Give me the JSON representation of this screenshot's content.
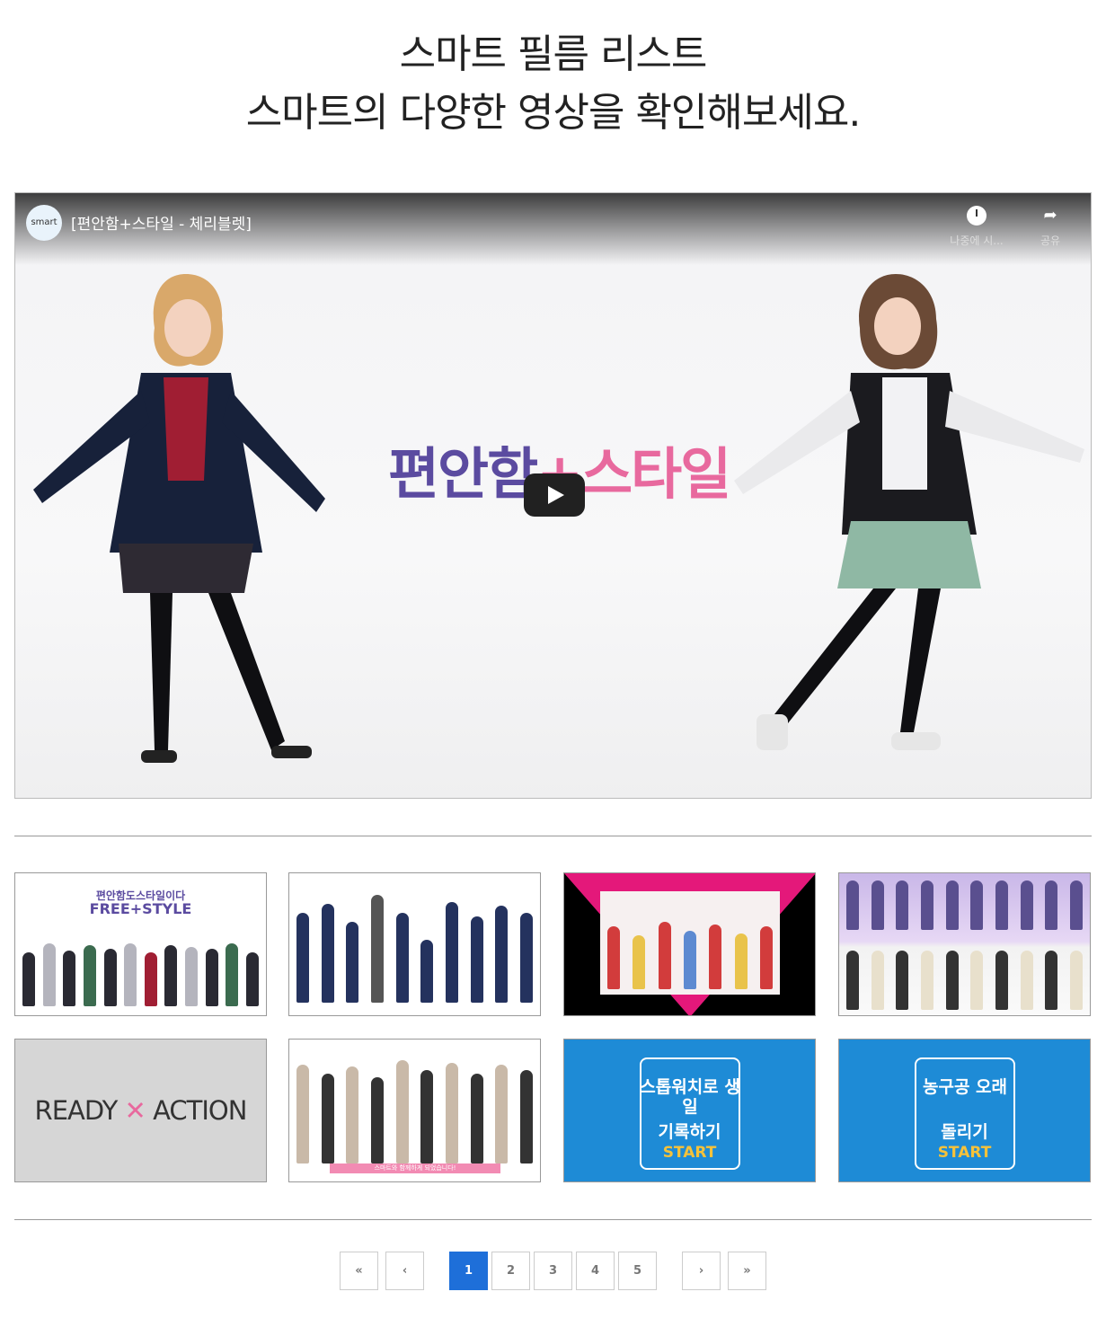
{
  "heading": {
    "line1": "스마트 필름 리스트",
    "line2": "스마트의 다양한 영상을 확인해보세요."
  },
  "video": {
    "channel_logo": "smart",
    "title": "[편안함+스타일 - 체리블렛]",
    "watch_later_label": "나중에 시...",
    "share_label": "공유",
    "overlay_text_a": "편안함",
    "overlay_text_b": "+스타일",
    "icons": [
      "clock-icon",
      "share-icon",
      "play-icon"
    ]
  },
  "thumbnails": [
    {
      "caption_top": "편안함도스타일이다",
      "caption_main": "FREE+STYLE",
      "bg": "#ffffff"
    },
    {
      "caption_top": "",
      "caption_main": "",
      "bg": "#ffffff"
    },
    {
      "caption_top": "",
      "caption_main": "",
      "bg": "#000000"
    },
    {
      "caption_top": "",
      "caption_main": "",
      "bg": "#c9b7e8"
    },
    {
      "caption_top": "READY",
      "caption_main": "ACTION",
      "bg": "#d6d6d6"
    },
    {
      "caption_top": "",
      "caption_main": "스마트와 함께하게 되었습니다!",
      "bg": "#ffffff"
    },
    {
      "caption_top": "스톱워치로 생일",
      "caption_main": "기록하기",
      "cta": "START",
      "bg": "#1e8bd6"
    },
    {
      "caption_top": "농구공 오래",
      "caption_main": "돌리기",
      "cta": "START",
      "bg": "#1e8bd6"
    }
  ],
  "pagination": {
    "first": "«",
    "prev": "‹",
    "pages": [
      "1",
      "2",
      "3",
      "4",
      "5"
    ],
    "current": "1",
    "next": "›",
    "last": "»"
  }
}
